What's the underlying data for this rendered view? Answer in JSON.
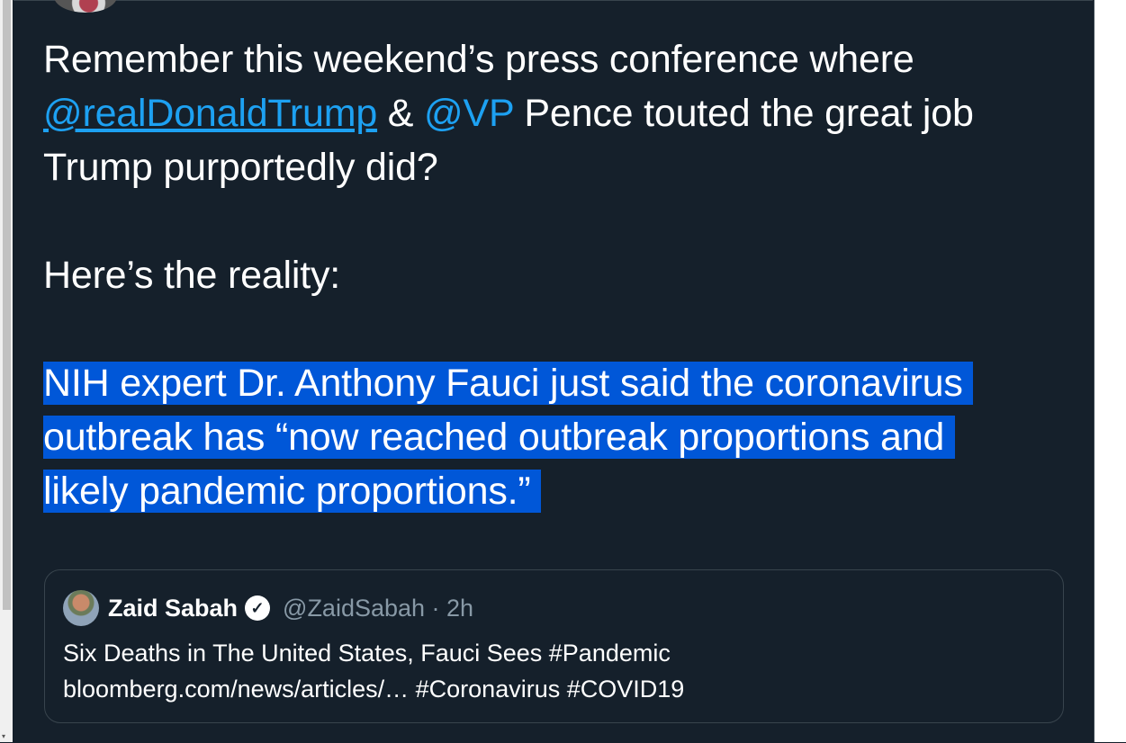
{
  "tweet": {
    "line1": "Remember this weekend’s press conference where",
    "mention1": "@realDonaldTrump",
    "amp": " & ",
    "mention2": "@VP",
    "line2_rest": " Pence touted the great job",
    "line3": "Trump purportedly did?",
    "line4": "Here’s the reality:",
    "hl1": "NIH expert Dr. Anthony Fauci just said the coronavirus ",
    "hl2": "outbreak has “now reached outbreak proportions and ",
    "hl3": "likely pandemic proportions.” "
  },
  "quote": {
    "name": "Zaid Sabah",
    "verified_icon": "✓",
    "handle": "@ZaidSabah · 2h",
    "body_line1": "Six Deaths in The United States, Fauci Sees #Pandemic",
    "body_line2": "bloomberg.com/news/articles/… #Coronavirus #COVID19"
  },
  "scrollbar": {
    "arrow": "▾"
  }
}
